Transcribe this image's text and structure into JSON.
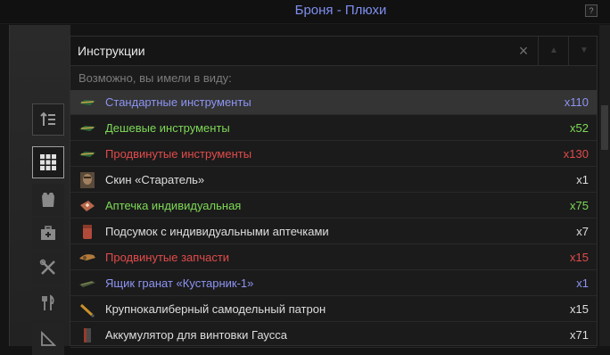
{
  "window": {
    "title": "Броня - Плюхи",
    "help_label": "?"
  },
  "search": {
    "value": "Инструкции",
    "clear_label": "×",
    "prev_label": "▲",
    "next_label": "▼"
  },
  "hint": "Возможно, вы имели в виду:",
  "colors": {
    "blue": "#8d94f2",
    "green": "#7ed957",
    "red": "#e24b4b",
    "white": "#dedede"
  },
  "items": [
    {
      "label": "Стандартные инструменты",
      "count": "x110",
      "color": "blue",
      "icon": "tools-icon",
      "selected": true
    },
    {
      "label": "Дешевые инструменты",
      "count": "x52",
      "color": "green",
      "icon": "tools-icon"
    },
    {
      "label": "Продвинутые инструменты",
      "count": "x130",
      "color": "red",
      "icon": "tools-icon"
    },
    {
      "label": "Скин «Старатель»",
      "count": "x1",
      "color": "white",
      "icon": "portrait-icon"
    },
    {
      "label": "Аптечка индивидуальная",
      "count": "x75",
      "color": "green",
      "icon": "medkit-icon"
    },
    {
      "label": "Подсумок с индивидуальными аптечками",
      "count": "x7",
      "color": "white",
      "icon": "pouch-icon"
    },
    {
      "label": "Продвинутые запчасти",
      "count": "x15",
      "color": "red",
      "icon": "parts-icon"
    },
    {
      "label": "Ящик гранат «Кустарник-1»",
      "count": "x1",
      "color": "blue",
      "icon": "grenade-crate-icon"
    },
    {
      "label": "Крупнокалиберный самодельный патрон",
      "count": "x15",
      "color": "white",
      "icon": "cartridge-icon"
    },
    {
      "label": "Аккумулятор для винтовки Гаусса",
      "count": "x71",
      "color": "white",
      "icon": "battery-icon"
    }
  ]
}
